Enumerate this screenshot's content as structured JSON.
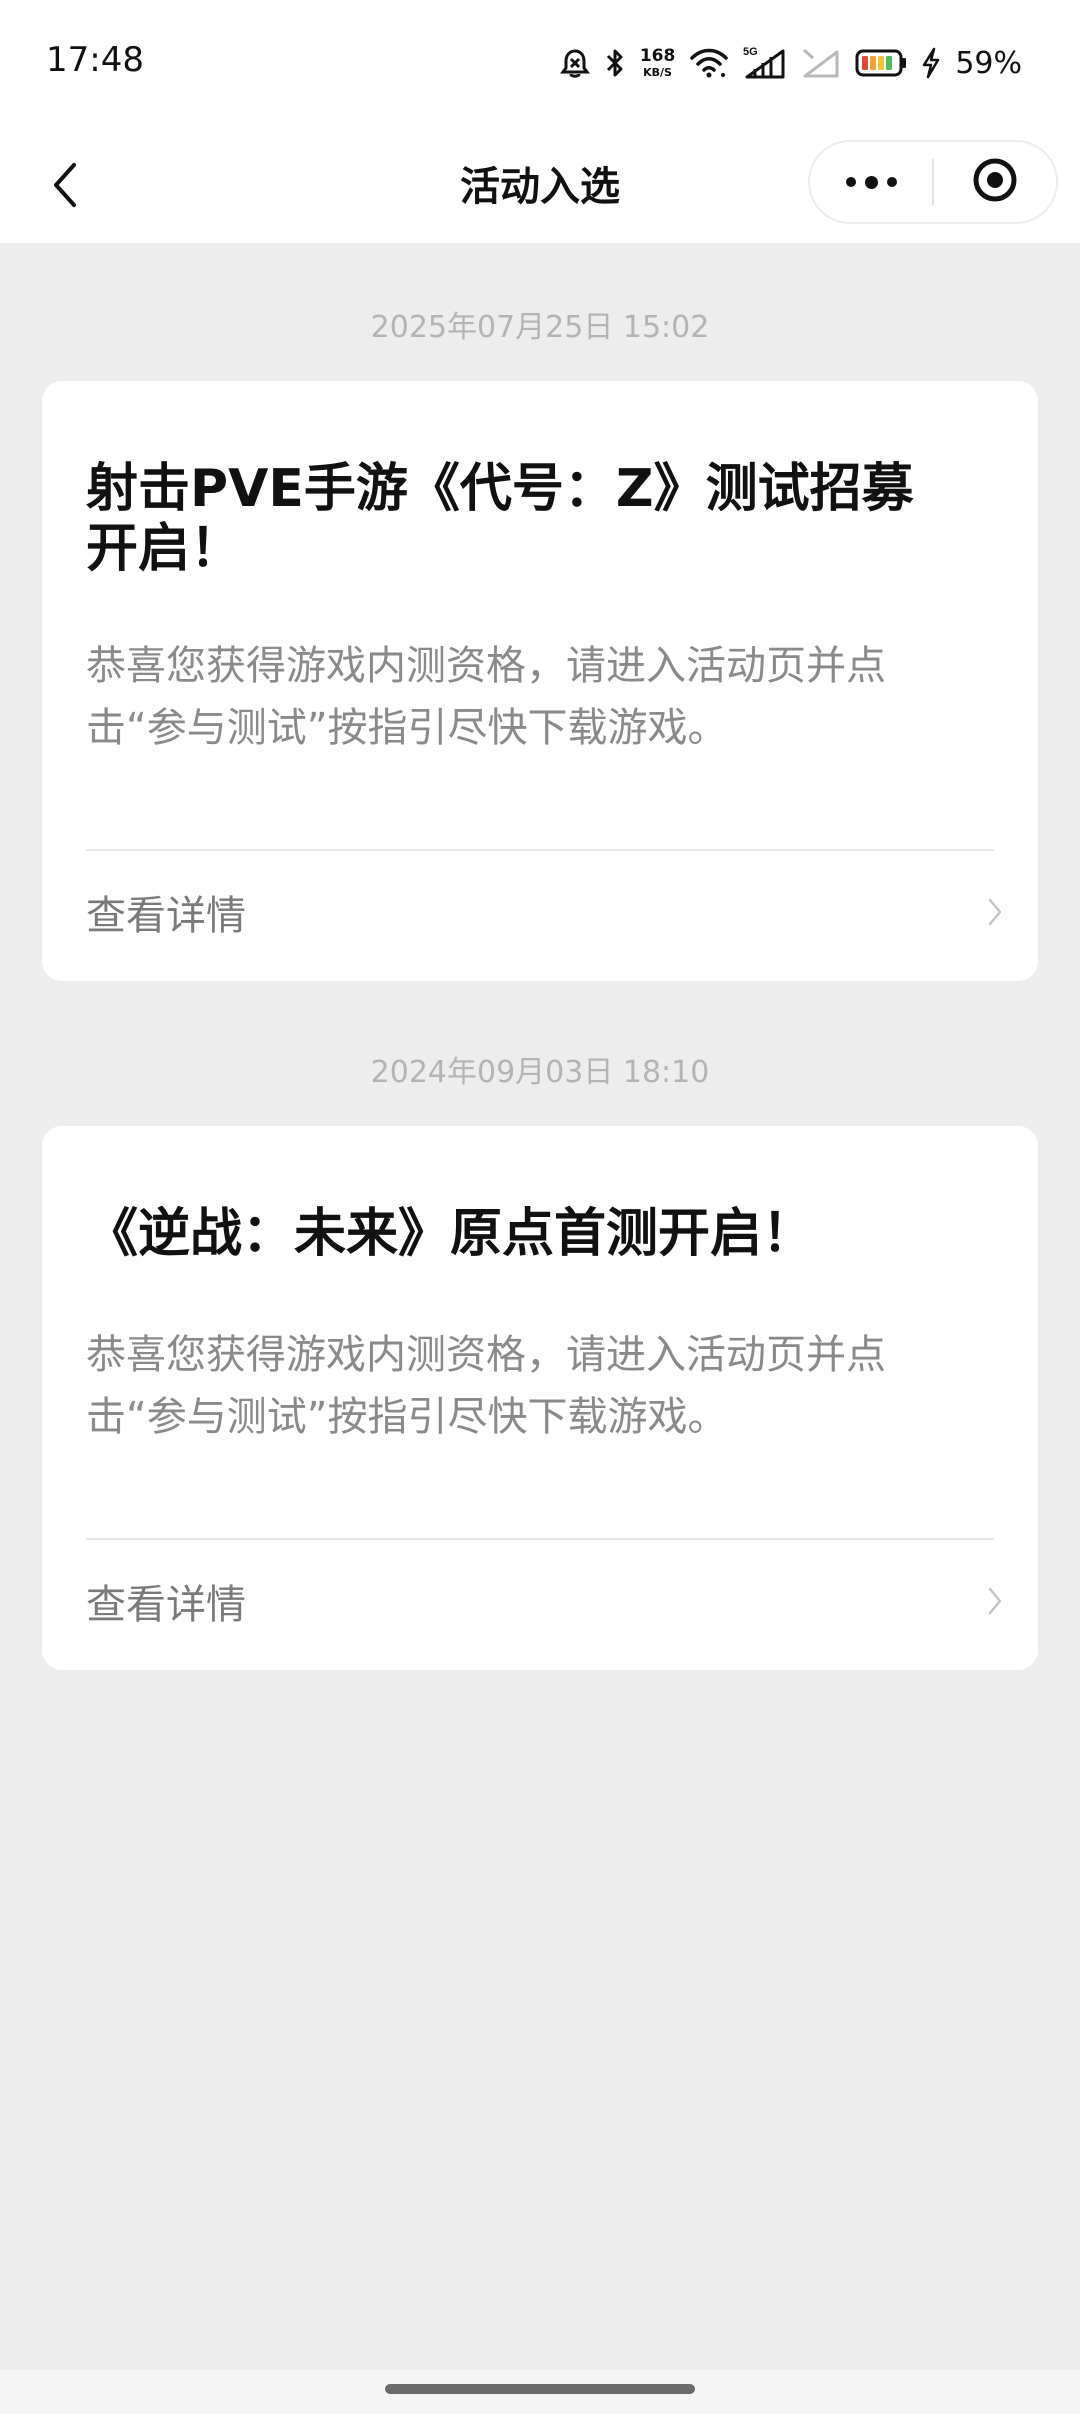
{
  "status_bar": {
    "time": "17:48",
    "net_speed_value": "168",
    "net_speed_unit": "KB/S",
    "network_type": "5G",
    "battery_percent": "59%",
    "icons": [
      "alarm-icon",
      "bluetooth-icon",
      "wifi-icon",
      "signal-5g-icon",
      "signal-empty-icon",
      "battery-icon",
      "charging-icon"
    ]
  },
  "title_bar": {
    "title": "活动入选",
    "back_icon": "chevron-left-icon",
    "more_icon": "more-dots-icon",
    "close_icon": "target-circle-icon"
  },
  "messages": [
    {
      "timestamp": "2025年07月25日 15:02",
      "title": "射击PVE手游《代号：Z》测试招募开启！",
      "description": "恭喜您获得游戏内测资格，请进入活动页并点击“参与测试”按指引尽快下载游戏。",
      "link_label": "查看详情"
    },
    {
      "timestamp": "2024年09月03日 18:10",
      "title": "《逆战：未来》原点首测开启！",
      "description": "恭喜您获得游戏内测资格，请进入活动页并点击“参与测试”按指引尽快下载游戏。",
      "link_label": "查看详情"
    }
  ],
  "colors": {
    "page_background": "#ededed",
    "card_background": "#ffffff",
    "title_text": "#111111",
    "secondary_text": "#8a8a8a",
    "timestamp_text": "#b4b4b4"
  }
}
